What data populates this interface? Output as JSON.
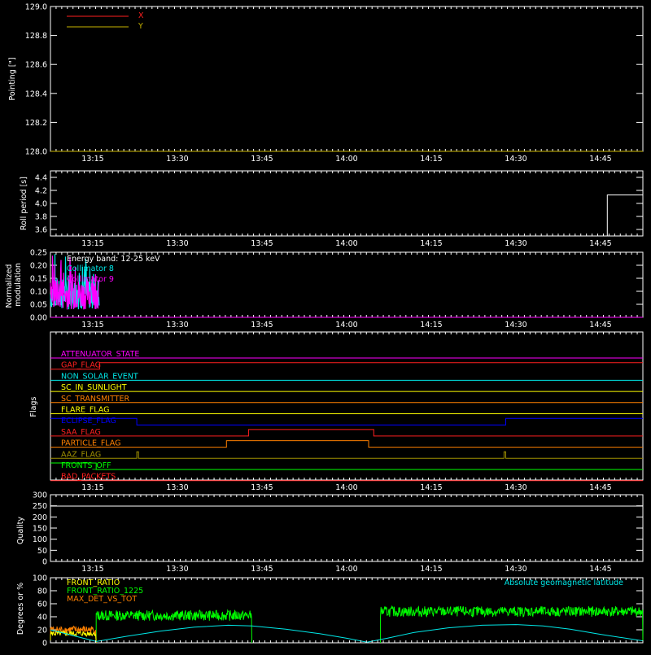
{
  "time_ticks": [
    "13:15",
    "13:30",
    "13:45",
    "14:00",
    "14:15",
    "14:30",
    "14:45"
  ],
  "time_ticks_hours": [
    13.25,
    13.5,
    13.75,
    14.0,
    14.25,
    14.5,
    14.75
  ],
  "x_range_hours": [
    13.125,
    14.875
  ],
  "colors": {
    "axis": "#ffffff",
    "red": "#ff2020",
    "olive": "#c8b400",
    "cyan": "#00e8e8",
    "magenta": "#ff00ff",
    "orange": "#ff8000",
    "yellow": "#ffff00",
    "blue": "#0000ff",
    "dark_yellow": "#a09000",
    "green": "#00ff00"
  },
  "chart_data": [
    {
      "id": "pointing",
      "type": "line",
      "ylabel": "Pointing [\"]",
      "ylim": [
        128.0,
        129.0
      ],
      "yticks": [
        "128.0",
        "128.2",
        "128.4",
        "128.6",
        "128.8",
        "129.0"
      ],
      "yticks_values": [
        128.0,
        128.2,
        128.4,
        128.6,
        128.8,
        129.0
      ],
      "legend": [
        {
          "name": "X",
          "color": "#ff2020"
        },
        {
          "name": "Y",
          "color": "#c8b400"
        }
      ],
      "series": [
        {
          "name": "Y",
          "color": "#c8b400",
          "x": [
            13.125,
            14.875
          ],
          "y": [
            128.0,
            128.0
          ]
        }
      ]
    },
    {
      "id": "roll",
      "type": "line",
      "ylabel": "Roll period [s]",
      "ylim": [
        3.5,
        4.5
      ],
      "yticks": [
        "3.6",
        "3.8",
        "4.0",
        "4.2",
        "4.4"
      ],
      "yticks_values": [
        3.6,
        3.8,
        4.0,
        4.2,
        4.4
      ],
      "series": [
        {
          "name": "roll",
          "color": "#ffffff",
          "x": [
            14.77,
            14.77,
            14.875
          ],
          "y": [
            3.5,
            4.13,
            4.13
          ]
        }
      ]
    },
    {
      "id": "modulation",
      "type": "line",
      "ylabel": "Normalized modulation",
      "ylim": [
        0.0,
        0.25
      ],
      "yticks": [
        "0.00",
        "0.05",
        "0.10",
        "0.15",
        "0.20",
        "0.25"
      ],
      "yticks_values": [
        0.0,
        0.05,
        0.1,
        0.15,
        0.2,
        0.25
      ],
      "annotations": [
        {
          "text": "Energy band: 12-25 keV",
          "color": "#ffffff"
        },
        {
          "text": "Collimator 8",
          "color": "#00e8e8"
        },
        {
          "text": "Collimator 9",
          "color": "#ff00ff"
        }
      ],
      "series": [
        {
          "name": "Collimator 8",
          "color": "#00e8e8",
          "active_range": [
            13.125,
            13.27
          ],
          "x": [
            13.125,
            14.875
          ],
          "y": [
            0.0,
            0.0
          ]
        },
        {
          "name": "Collimator 9",
          "color": "#ff00ff",
          "active_range": [
            13.125,
            13.27
          ],
          "x": [
            13.125,
            14.875
          ],
          "y": [
            0.0,
            0.0
          ]
        }
      ]
    },
    {
      "id": "flags",
      "type": "line",
      "ylabel": "Flags",
      "series": [
        {
          "name": "ATTENUATOR_STATE",
          "color": "#ff00ff",
          "x": [
            13.125,
            14.875
          ],
          "y": [
            0,
            0
          ]
        },
        {
          "name": "GAP_FLAG",
          "color": "#ff2020",
          "x": [
            13.125,
            13.27,
            13.27,
            14.875
          ],
          "y": [
            0,
            0,
            1,
            1
          ]
        },
        {
          "name": "NON_SOLAR_EVENT",
          "color": "#00e8e8",
          "x": [
            13.125,
            14.875
          ],
          "y": [
            0,
            0
          ]
        },
        {
          "name": "SC_IN_SUNLIGHT",
          "color": "#ffff00",
          "x": [
            13.125,
            14.875
          ],
          "y": [
            0,
            0
          ]
        },
        {
          "name": "SC_TRANSMITTER",
          "color": "#ff8000",
          "x": [
            13.125,
            14.875
          ],
          "y": [
            0,
            0
          ]
        },
        {
          "name": "FLARE_FLAG",
          "color": "#ffff00",
          "x": [
            13.125,
            14.875
          ],
          "y": [
            0,
            0
          ]
        },
        {
          "name": "ECLIPSE_FLAG",
          "color": "#0000ff",
          "x": [
            13.125,
            13.38,
            13.38,
            14.47,
            14.47,
            14.875
          ],
          "y": [
            1,
            1,
            0,
            0,
            1,
            1
          ]
        },
        {
          "name": "SAA_FLAG",
          "color": "#ff2020",
          "x": [
            13.125,
            13.71,
            13.71,
            14.08,
            14.08,
            14.875
          ],
          "y": [
            0,
            0,
            1,
            1,
            0,
            0
          ]
        },
        {
          "name": "PARTICLE_FLAG",
          "color": "#ff8000",
          "x": [
            13.125,
            13.645,
            13.645,
            14.065,
            14.065,
            14.875
          ],
          "y": [
            0,
            0,
            1,
            1,
            0,
            0
          ]
        },
        {
          "name": "AAZ_FLAG",
          "color": "#a09000",
          "x": [
            13.125,
            13.38,
            13.38,
            13.385,
            13.385,
            14.465,
            14.465,
            14.47,
            14.47,
            14.875
          ],
          "y": [
            0,
            0,
            1,
            1,
            0,
            0,
            1,
            1,
            0,
            0
          ]
        },
        {
          "name": "FRONTS_OFF",
          "color": "#00ff00",
          "x": [
            13.125,
            13.26,
            13.26,
            14.875
          ],
          "y": [
            1,
            1,
            0,
            0
          ]
        },
        {
          "name": "BAD_PACKETS",
          "color": "#ff2020",
          "x": [
            13.125,
            14.875
          ],
          "y": [
            0,
            0
          ]
        }
      ]
    },
    {
      "id": "quality",
      "type": "line",
      "ylabel": "Quality",
      "ylim": [
        0,
        300
      ],
      "yticks": [
        "0",
        "50",
        "100",
        "150",
        "200",
        "250",
        "300"
      ],
      "yticks_values": [
        0,
        50,
        100,
        150,
        200,
        250,
        300
      ],
      "series": []
    },
    {
      "id": "geomag",
      "type": "line",
      "ylabel": "Degrees or %",
      "ylim": [
        0,
        100
      ],
      "yticks": [
        "0",
        "20",
        "40",
        "60",
        "80",
        "100"
      ],
      "yticks_values": [
        0,
        20,
        40,
        60,
        80,
        100
      ],
      "legend": [
        {
          "name": "FRONT_RATIO",
          "color": "#ffff00"
        },
        {
          "name": "FRONT_RATIO_1225",
          "color": "#00ff00"
        },
        {
          "name": "MAX_DET_VS_TOT",
          "color": "#ff8000"
        },
        {
          "name": "Absolute geomagnetic latitude",
          "color": "#00e8e8"
        }
      ],
      "series": [
        {
          "name": "FRONT_RATIO_1225",
          "color": "#00ff00",
          "segments": [
            [
              13.26,
              13.72,
              42
            ],
            [
              14.1,
              14.875,
              48
            ]
          ],
          "spread": 8
        },
        {
          "name": "MAX_DET_VS_TOT",
          "color": "#ff8000",
          "segments": [
            [
              13.125,
              13.26,
              20
            ]
          ],
          "spread": 6
        },
        {
          "name": "FRONT_RATIO",
          "color": "#ffff00",
          "segments": [
            [
              13.125,
              13.26,
              14
            ]
          ],
          "spread": 4
        },
        {
          "name": "Absolute geomagnetic latitude",
          "color": "#00e8e8",
          "x": [
            13.125,
            13.2,
            13.26,
            13.35,
            13.45,
            13.55,
            13.65,
            13.72,
            13.82,
            13.92,
            14.0,
            14.06,
            14.12,
            14.2,
            14.3,
            14.4,
            14.5,
            14.58,
            14.66,
            14.75,
            14.875
          ],
          "y": [
            20,
            10,
            2,
            10,
            18,
            24,
            27,
            26,
            21,
            14,
            7,
            1,
            7,
            16,
            23,
            27,
            28,
            26,
            21,
            13,
            3
          ]
        }
      ]
    }
  ]
}
